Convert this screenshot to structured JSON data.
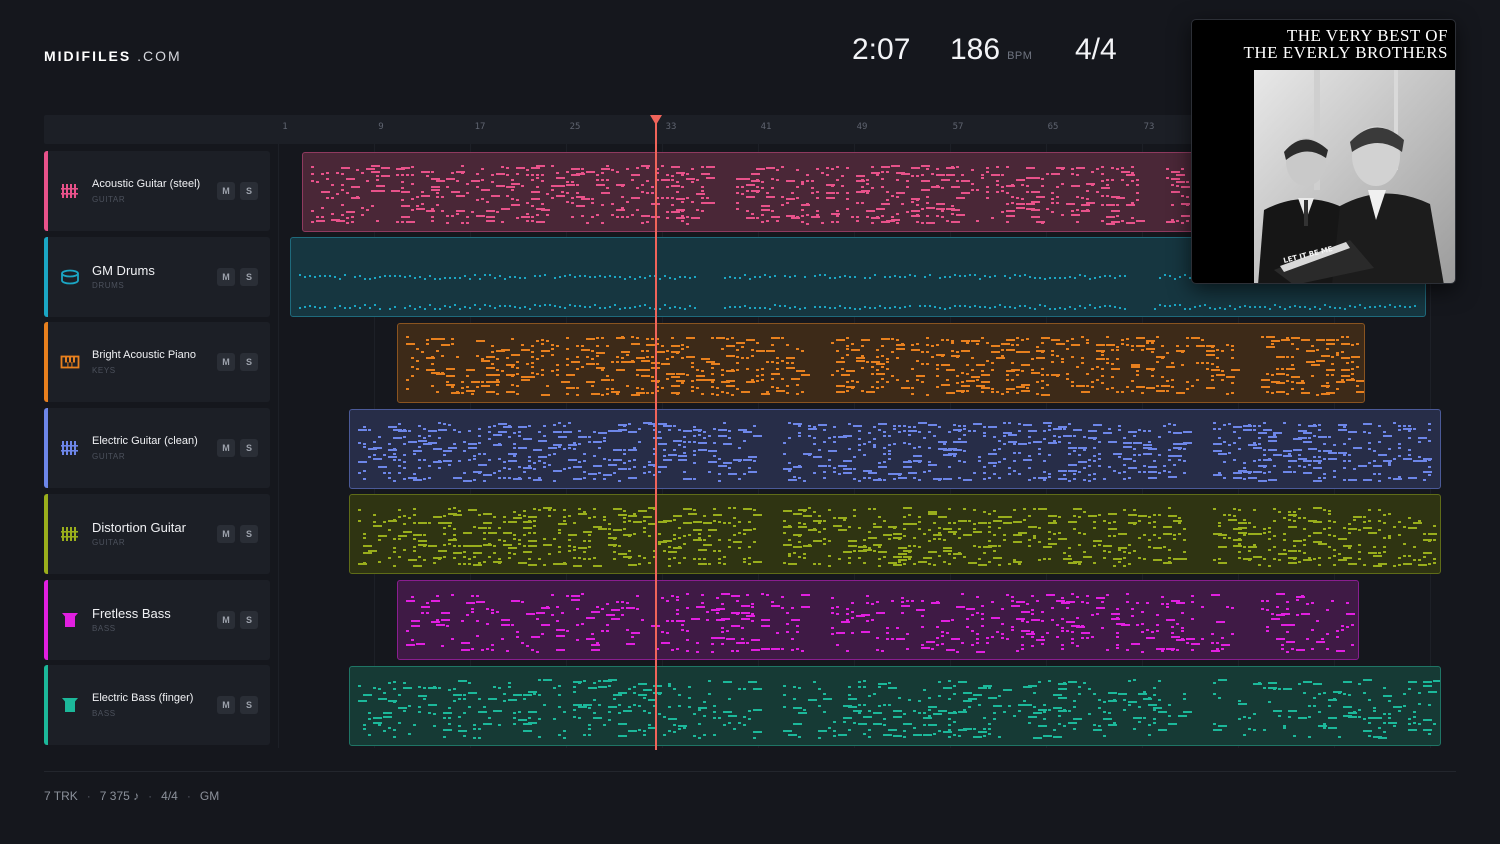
{
  "brand": {
    "name": "MIDIFILES",
    "tld": ".COM"
  },
  "transport": {
    "time": "2:07",
    "bpm": "186",
    "bpm_unit": "BPM",
    "meter": "4/4"
  },
  "ruler": {
    "ticks": [
      "1",
      "9",
      "17",
      "25",
      "33",
      "41",
      "49",
      "57",
      "65",
      "73"
    ]
  },
  "tracks": [
    {
      "name": "Acoustic Guitar (steel)",
      "category": "GUITAR",
      "icon": "guitar-icon",
      "color": "#e8528a",
      "mute": "M",
      "solo": "S"
    },
    {
      "name": "GM Drums",
      "category": "DRUMS",
      "icon": "drum-icon",
      "color": "#1ba6c4",
      "mute": "M",
      "solo": "S"
    },
    {
      "name": "Bright Acoustic Piano",
      "category": "KEYS",
      "icon": "piano-icon",
      "color": "#e8801e",
      "mute": "M",
      "solo": "S"
    },
    {
      "name": "Electric Guitar (clean)",
      "category": "GUITAR",
      "icon": "guitar-icon",
      "color": "#6d86e8",
      "mute": "M",
      "solo": "S"
    },
    {
      "name": "Distortion Guitar",
      "category": "GUITAR",
      "icon": "guitar-icon",
      "color": "#9aae1c",
      "mute": "M",
      "solo": "S"
    },
    {
      "name": "Fretless Bass",
      "category": "BASS",
      "icon": "bass-icon",
      "color": "#e11fe0",
      "mute": "M",
      "solo": "S"
    },
    {
      "name": "Electric Bass (finger)",
      "category": "BASS",
      "icon": "bass-icon",
      "color": "#1cb89a",
      "mute": "M",
      "solo": "S"
    }
  ],
  "album": {
    "title_line1": "THE VERY BEST OF",
    "title_line2": "THE EVERLY BROTHERS",
    "record_text": "LET IT BE ME"
  },
  "footer": {
    "tracks": "7 TRK",
    "notes": "7 375 ♪",
    "meter": "4/4",
    "standard": "GM"
  }
}
